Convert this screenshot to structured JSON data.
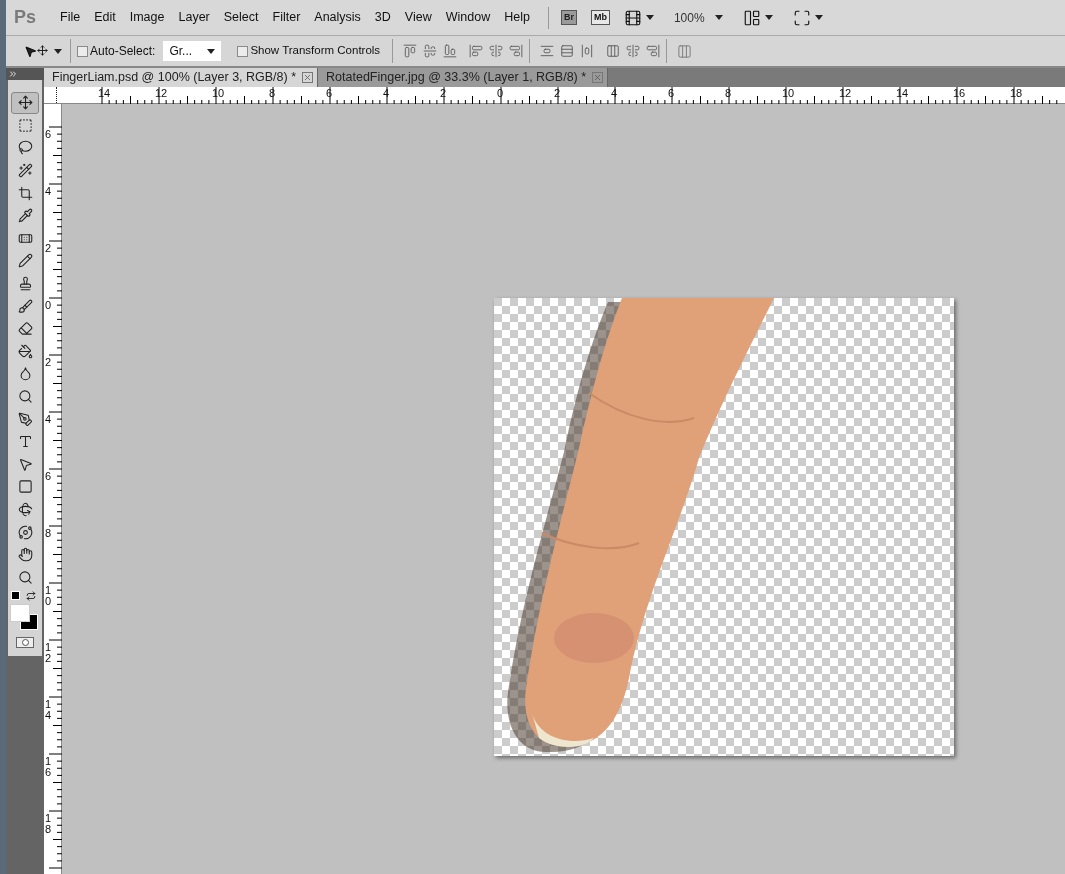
{
  "app": {
    "logo": "Ps",
    "menu": [
      "File",
      "Edit",
      "Image",
      "Layer",
      "Select",
      "Filter",
      "Analysis",
      "3D",
      "View",
      "Window",
      "Help"
    ],
    "bridge_badge": "Br",
    "mini_bridge_badge": "Mb",
    "zoom": "100%"
  },
  "options_bar": {
    "auto_select": {
      "label": "Auto-Select:",
      "checked": false
    },
    "auto_select_target": "Gr...",
    "show_transform_controls": {
      "label": "Show Transform Controls",
      "checked": false
    }
  },
  "tabs": [
    {
      "label": "FingerLiam.psd @ 100% (Layer 3, RGB/8) *",
      "selected": true
    },
    {
      "label": "RotatedFinger.jpg @ 33.3% (Layer 1, RGB/8) *",
      "selected": false
    }
  ],
  "rulers": {
    "horizontal": [
      "14",
      "12",
      "10",
      "8",
      "6",
      "4",
      "2",
      "0",
      "2",
      "4",
      "6",
      "8",
      "10",
      "12",
      "14",
      "16",
      "18"
    ],
    "vertical": [
      "6",
      "4",
      "2",
      "0",
      "2",
      "4",
      "6",
      "8",
      "10",
      "12",
      "14",
      "16",
      "18"
    ]
  },
  "tools": [
    {
      "kind": "move",
      "selected": true
    },
    {
      "kind": "marquee",
      "selected": false
    },
    {
      "kind": "lasso",
      "selected": false
    },
    {
      "kind": "wand",
      "selected": false
    },
    {
      "kind": "crop",
      "selected": false
    },
    {
      "kind": "eyedropper",
      "selected": false
    },
    {
      "kind": "heal",
      "selected": false
    },
    {
      "kind": "brush",
      "selected": false
    },
    {
      "kind": "stamp",
      "selected": false
    },
    {
      "kind": "history",
      "selected": false
    },
    {
      "kind": "eraser",
      "selected": false
    },
    {
      "kind": "bucket",
      "selected": false
    },
    {
      "kind": "blur",
      "selected": false
    },
    {
      "kind": "dodge",
      "selected": false
    },
    {
      "kind": "pen",
      "selected": false
    },
    {
      "kind": "type",
      "selected": false
    },
    {
      "kind": "path",
      "selected": false
    },
    {
      "kind": "shape",
      "selected": false
    },
    {
      "kind": "rotate3d",
      "selected": false
    },
    {
      "kind": "orbit3d",
      "selected": false
    },
    {
      "kind": "hand",
      "selected": false
    },
    {
      "kind": "zoom",
      "selected": false
    }
  ]
}
